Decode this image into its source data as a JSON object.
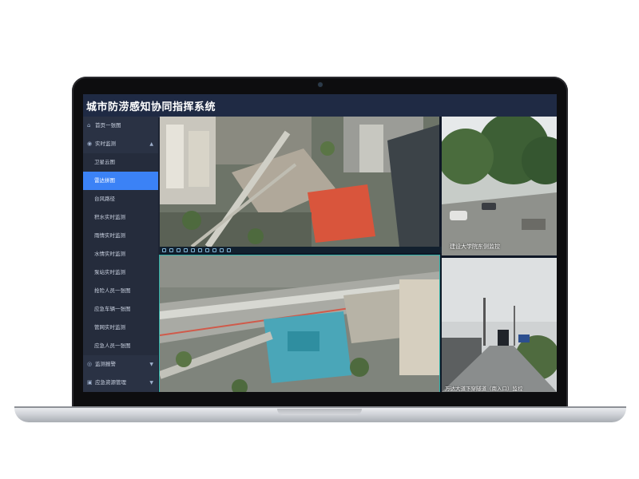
{
  "app": {
    "title": "城市防涝感知协同指挥系统"
  },
  "sidebar": {
    "items": [
      {
        "label": "首页一张图",
        "icon": "home-icon",
        "type": "top"
      },
      {
        "label": "实时监测",
        "icon": "monitor-icon",
        "type": "top",
        "expanded": true
      },
      {
        "label": "卫星云图",
        "type": "sub"
      },
      {
        "label": "雷达拼图",
        "type": "sub",
        "active": true
      },
      {
        "label": "台风路径",
        "type": "sub"
      },
      {
        "label": "积水实时监测",
        "type": "sub"
      },
      {
        "label": "雨情实时监测",
        "type": "sub"
      },
      {
        "label": "水情实时监测",
        "type": "sub"
      },
      {
        "label": "泵站实时监测",
        "type": "sub"
      },
      {
        "label": "抢险人员一张图",
        "type": "sub"
      },
      {
        "label": "应急车辆一张图",
        "type": "sub"
      },
      {
        "label": "管网实时监测",
        "type": "sub"
      },
      {
        "label": "应急人员一张图",
        "type": "sub"
      },
      {
        "label": "监测报警",
        "icon": "alarm-icon",
        "type": "top"
      },
      {
        "label": "应急资源管理",
        "icon": "resource-icon",
        "type": "top"
      }
    ]
  },
  "video": {
    "captions": {
      "cam2": "建设大学院东侧监控",
      "cam4": "万达大道下穿隧道（南入口）监控"
    }
  },
  "colors": {
    "accent": "#3b82f6",
    "header_bg": "#1f2a44",
    "sidebar_bg": "#2a3244"
  }
}
